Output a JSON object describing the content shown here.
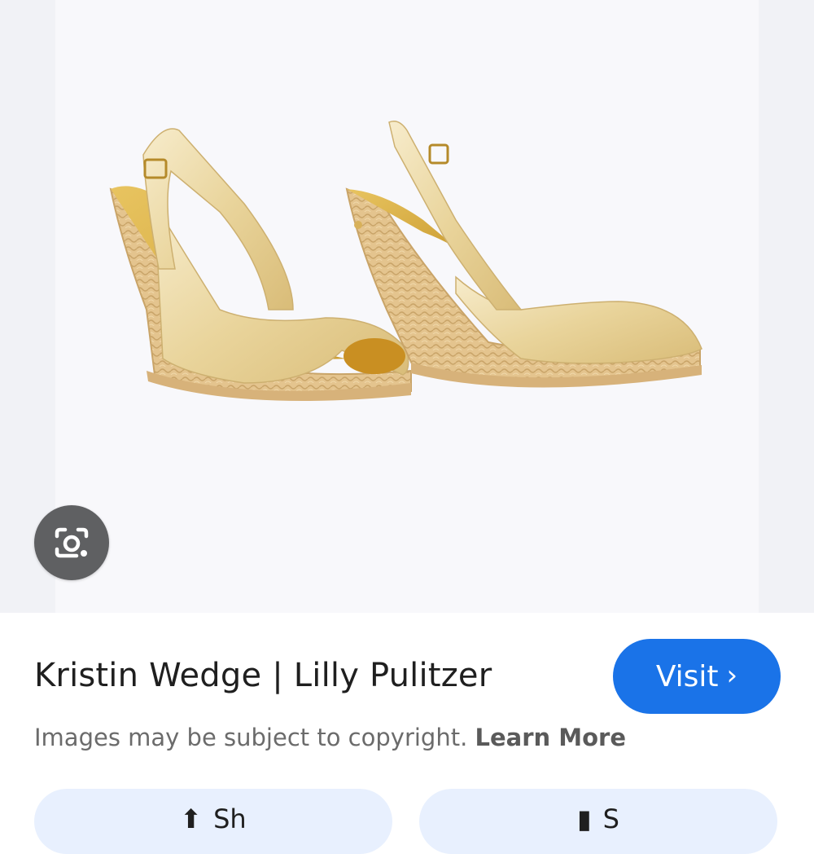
{
  "result": {
    "title": "Kristin Wedge | Lilly Pulitzer",
    "image_alt": "gold wedge slingback sandals",
    "lens_icon": "google-lens-camera-icon"
  },
  "visit": {
    "label": "Visit",
    "icon": "chevron-right-icon",
    "color": "#1a73e8"
  },
  "notice": {
    "text": "Images may be subject to copyright.",
    "link": "Learn More"
  },
  "actions": [
    {
      "label": "Sh",
      "icon": "share-icon"
    },
    {
      "label": "S",
      "icon": "bookmark-icon"
    }
  ]
}
